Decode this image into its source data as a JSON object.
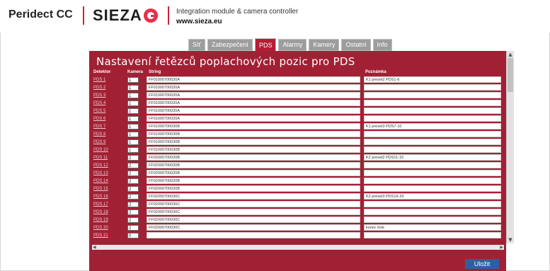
{
  "header": {
    "product": "Peridect CC",
    "logo_text": "SIEZA",
    "tagline": "Integration module & camera controller",
    "url": "www.sieza.eu"
  },
  "tabs": [
    {
      "label": "Síť",
      "active": false
    },
    {
      "label": "Zabezpečení",
      "active": false
    },
    {
      "label": "PDS",
      "active": true
    },
    {
      "label": "Alarmy",
      "active": false
    },
    {
      "label": "Kamery",
      "active": false
    },
    {
      "label": "Ostatní",
      "active": false
    },
    {
      "label": "Info",
      "active": false
    }
  ],
  "panel": {
    "title": "Nastavení řetězců poplachových pozic pro PDS",
    "columns": {
      "detektor": "Detektor",
      "kamera": "Kamera",
      "string": "String",
      "poznamka": "Poznámka"
    }
  },
  "rows": [
    {
      "det": "PDS 1",
      "cam": "1",
      "str": "FF01000700020A",
      "note": "K1 preset2 PDS1-6"
    },
    {
      "det": "PDS 2",
      "cam": "1",
      "str": "FF01000700020A",
      "note": ""
    },
    {
      "det": "PDS 3",
      "cam": "1",
      "str": "FF01000700020A",
      "note": ""
    },
    {
      "det": "PDS 4",
      "cam": "1",
      "str": "FF01000700020A",
      "note": ""
    },
    {
      "det": "PDS 5",
      "cam": "1",
      "str": "FF01000700020A",
      "note": ""
    },
    {
      "det": "PDS 6",
      "cam": "1",
      "str": "FF01000700020A",
      "note": ""
    },
    {
      "det": "PDS 7",
      "cam": "1",
      "str": "FF01000700030B",
      "note": "K1 preset3 PDS7-10"
    },
    {
      "det": "PDS 8",
      "cam": "1",
      "str": "FF01000700030B",
      "note": ""
    },
    {
      "det": "PDS 9",
      "cam": "1",
      "str": "FF01000700030B",
      "note": ""
    },
    {
      "det": "PDS 10",
      "cam": "1",
      "str": "FF01000700030B",
      "note": ""
    },
    {
      "det": "PDS 11",
      "cam": "2",
      "str": "FF02000700020B",
      "note": "K2 preset2 PDS11-15"
    },
    {
      "det": "PDS 12",
      "cam": "2",
      "str": "FF02000700020B",
      "note": ""
    },
    {
      "det": "PDS 13",
      "cam": "2",
      "str": "FF02000700020B",
      "note": ""
    },
    {
      "det": "PDS 14",
      "cam": "2",
      "str": "FF02000700020B",
      "note": ""
    },
    {
      "det": "PDS 15",
      "cam": "2",
      "str": "FF02000700020B",
      "note": ""
    },
    {
      "det": "PDS 16",
      "cam": "2",
      "str": "FF02000700030C",
      "note": "K2 preset3 PDS16-20"
    },
    {
      "det": "PDS 17",
      "cam": "2",
      "str": "FF02000700030C",
      "note": ""
    },
    {
      "det": "PDS 18",
      "cam": "2",
      "str": "FF02000700030C",
      "note": ""
    },
    {
      "det": "PDS 19",
      "cam": "2",
      "str": "FF02000700030C",
      "note": ""
    },
    {
      "det": "PDS 20",
      "cam": "2",
      "str": "FF02000700030C",
      "note": "konec linie"
    },
    {
      "det": "PDS 21",
      "cam": "0",
      "str": "",
      "note": ""
    }
  ],
  "buttons": {
    "save": "Uložit"
  },
  "colors": {
    "accent": "#a22034",
    "active_tab": "#b41e35",
    "save_button": "#2e5fa6"
  },
  "icons": {
    "scroll_up": "triangle-up-icon",
    "scroll_down": "triangle-down-icon",
    "scroll_left": "triangle-left-icon",
    "scroll_right": "triangle-right-icon"
  }
}
